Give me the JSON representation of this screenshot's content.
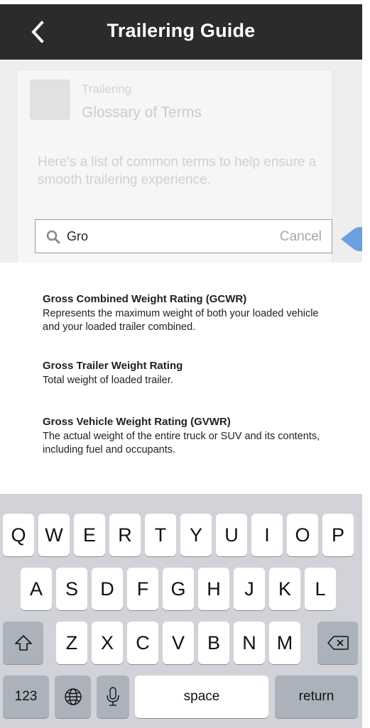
{
  "header": {
    "title": "Trailering Guide",
    "back_icon": "chevron-left-icon"
  },
  "card": {
    "breadcrumb": "Trailering",
    "subtitle": "Glossary of Terms",
    "intro": "Here's a list of common terms to help ensure a smooth trailering experience."
  },
  "search": {
    "value": "Gro",
    "cancel_label": "Cancel",
    "icon": "search-icon"
  },
  "hint": {
    "char": "3"
  },
  "results": [
    {
      "title": "Gross Combined Weight Rating (GCWR)",
      "desc": "Represents the maximum weight of both your loaded vehicle and your loaded trailer combined."
    },
    {
      "title": "Gross Trailer Weight Rating",
      "desc": "Total weight of loaded trailer."
    },
    {
      "title": "Gross Vehicle Weight Rating (GVWR)",
      "desc": "The actual weight of the entire truck or SUV and its contents, including fuel and occupants."
    }
  ],
  "keyboard": {
    "row1": [
      "Q",
      "W",
      "E",
      "R",
      "T",
      "Y",
      "U",
      "I",
      "O",
      "P"
    ],
    "row2": [
      "A",
      "S",
      "D",
      "F",
      "G",
      "H",
      "J",
      "K",
      "L"
    ],
    "row3": [
      "Z",
      "X",
      "C",
      "V",
      "B",
      "N",
      "M"
    ],
    "numbers_label": "123",
    "space_label": "space",
    "return_label": "return",
    "colors": {
      "background": "#d1d3d9",
      "key": "#ffffff",
      "special_key": "#acb2bc"
    }
  },
  "colors": {
    "header_bg": "#2b2b2b",
    "hint_pointer": "#6a9fe0"
  }
}
